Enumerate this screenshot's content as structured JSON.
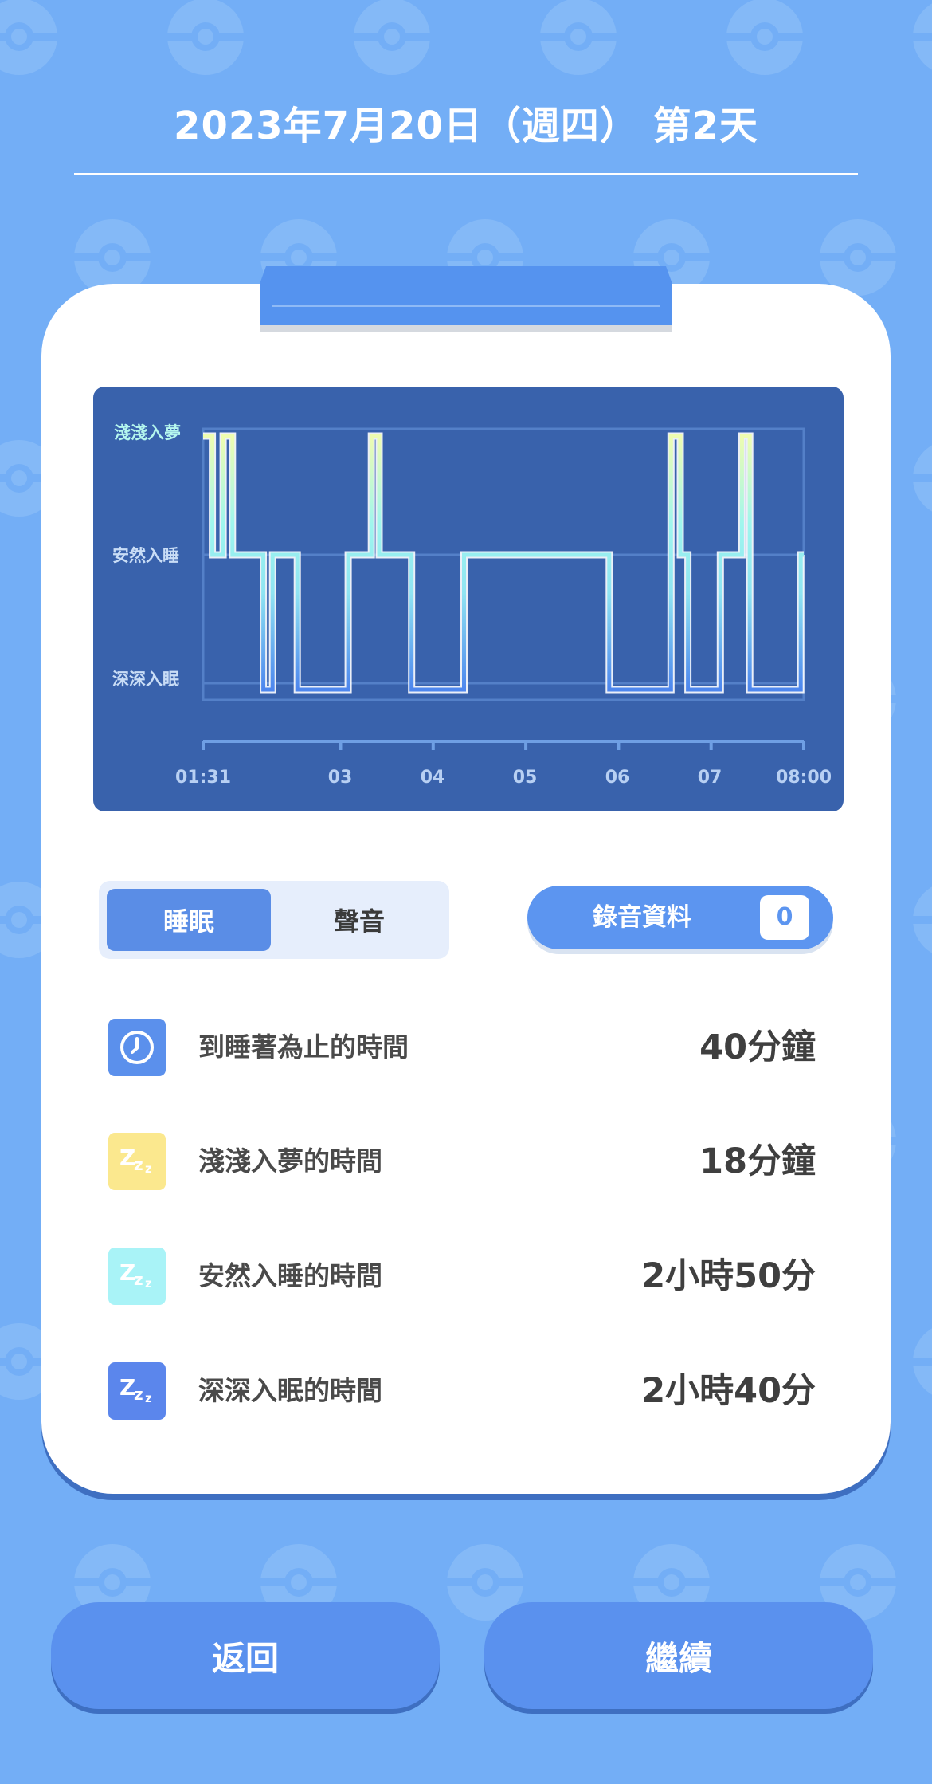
{
  "header": {
    "title": "2023年7月20日（週四） 第2天"
  },
  "chart_data": {
    "type": "line",
    "title": "",
    "xlabel": "",
    "ylabel": "",
    "y_categories": [
      "深深入眠",
      "安然入睡",
      "淺淺入夢"
    ],
    "x_tick_labels": [
      "01:31",
      "03",
      "04",
      "05",
      "06",
      "07",
      "08:00"
    ],
    "x_ticks_hours": [
      1.517,
      3,
      4,
      5,
      6,
      7,
      8
    ],
    "xlim": [
      1.517,
      8.0
    ],
    "grid": true,
    "series": [
      {
        "x": [
          1.517,
          1.617,
          1.617,
          1.733,
          1.733,
          1.833,
          1.833,
          2.167,
          2.167,
          2.267,
          2.267,
          2.533,
          2.533,
          3.083,
          3.083,
          3.333,
          3.333,
          3.417,
          3.417,
          3.767,
          3.767,
          4.333,
          4.333,
          5.9,
          5.9,
          6.567,
          6.567,
          6.667,
          6.667,
          6.75,
          6.75,
          7.1,
          7.1,
          7.333,
          7.333,
          7.417,
          7.417,
          7.967,
          7.967,
          8.0
        ],
        "y": [
          2,
          2,
          1,
          1,
          2,
          2,
          1,
          1,
          0,
          0,
          1,
          1,
          0,
          0,
          1,
          1,
          2,
          2,
          1,
          1,
          0,
          0,
          1,
          1,
          0,
          0,
          2,
          2,
          1,
          1,
          0,
          0,
          1,
          1,
          2,
          2,
          0,
          0,
          1,
          1
        ]
      }
    ]
  },
  "tabs": {
    "sleep": "睡眠",
    "sound": "聲音",
    "active": "sleep"
  },
  "recording": {
    "label": "錄音資料",
    "count": "0"
  },
  "stats": [
    {
      "icon": "clock-icon",
      "label": "到睡著為止的時間",
      "value": "40分鐘",
      "color": "#5b90ec"
    },
    {
      "icon": "zzz-light-icon",
      "label": "淺淺入夢的時間",
      "value": "18分鐘",
      "color": "#fbe88e"
    },
    {
      "icon": "zzz-medium-icon",
      "label": "安然入睡的時間",
      "value": "2小時50分",
      "color": "#a9f3f7"
    },
    {
      "icon": "zzz-deep-icon",
      "label": "深深入眠的時間",
      "value": "2小時40分",
      "color": "#5b86ec"
    }
  ],
  "buttons": {
    "back": "返回",
    "next": "繼續"
  },
  "colors": {
    "background": "#73aef6",
    "chart_bg": "#3962ac",
    "accent": "#5a91ee",
    "light_sleep": "#eefcb0",
    "medium_sleep": "#9ff6ee",
    "deep_sleep": "#4d86ee"
  }
}
